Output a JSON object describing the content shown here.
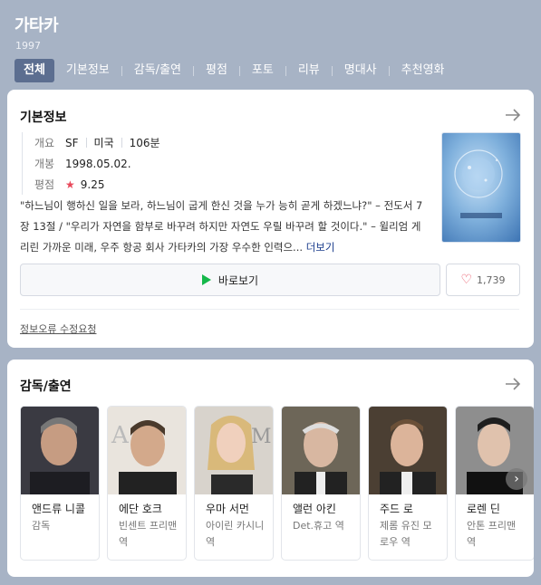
{
  "header": {
    "title": "가타카",
    "year": "1997",
    "tabs": [
      {
        "label": "전체",
        "active": true
      },
      {
        "label": "기본정보"
      },
      {
        "label": "감독/출연"
      },
      {
        "label": "평점"
      },
      {
        "label": "포토"
      },
      {
        "label": "리뷰"
      },
      {
        "label": "명대사"
      },
      {
        "label": "추천영화"
      }
    ]
  },
  "basic": {
    "title": "기본정보",
    "overview_label": "개요",
    "genre": "SF",
    "country": "미국",
    "runtime": "106분",
    "release_label": "개봉",
    "release": "1998.05.02.",
    "rating_label": "평점",
    "rating": "9.25",
    "description": "\"하느님이 행하신 일을 보라, 하느님이 굽게 한신 것을 누가 능히 곧게 하겠느냐?\" – 전도서 7장 13절 / \"우리가 자연을 함부로 바꾸려 하지만 자연도 우릴 바꾸려 할 것이다.\" – 윌리엄 게리린 가까운 미래, 우주 항공 회사 가타카의 가장 우수한 인력으...",
    "more": "더보기",
    "watch": "바로보기",
    "likes": "1,739",
    "report": "정보오류 수정요청"
  },
  "cast": {
    "title": "감독/출연",
    "people": [
      {
        "name": "앤드류 니콜",
        "role": "감독"
      },
      {
        "name": "에단 호크",
        "role": "빈센트 프리맨 역"
      },
      {
        "name": "우마 서먼",
        "role": "아이린 카시니 역"
      },
      {
        "name": "앨런 아킨",
        "role": "Det.휴고 역"
      },
      {
        "name": "주드 로",
        "role": "제롬 유진 모로우 역"
      },
      {
        "name": "로렌 딘",
        "role": "안톤 프리맨 역"
      }
    ]
  },
  "colors": {
    "background": "#a7b3c5",
    "active_tab": "#5c6e90",
    "accent_red": "#e8485a",
    "play_green": "#15b84a",
    "link_blue": "#1a3c8c"
  },
  "icons": [
    "arrow-right-icon",
    "star-icon",
    "play-icon",
    "heart-icon",
    "chevron-right-icon"
  ]
}
